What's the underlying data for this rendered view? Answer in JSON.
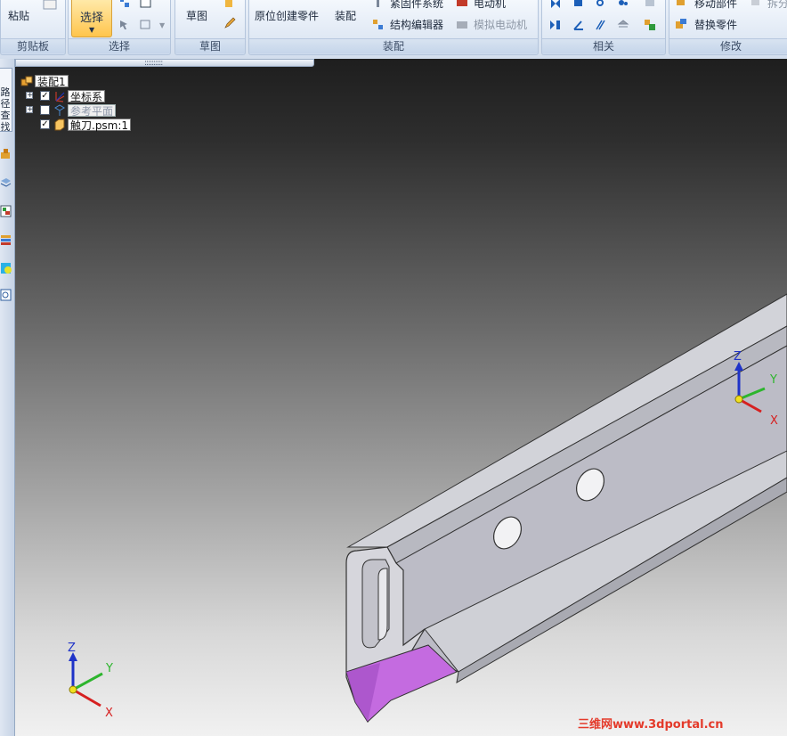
{
  "ribbon": {
    "clipboard": {
      "paste_label": "粘贴",
      "group_title": "剪贴板"
    },
    "select": {
      "select_label": "选择",
      "group_title": "选择"
    },
    "sketch": {
      "sketch_label": "草图",
      "group_title": "草图"
    },
    "assembly": {
      "inplace_create_label": "原位创建零件",
      "assemble_label": "装配",
      "fastener_label": "紧固件系统",
      "structure_editor_label": "结构编辑器",
      "motor_label": "电动机",
      "simulate_motor_label": "模拟电动机",
      "group_title": "装配"
    },
    "relate": {
      "group_title": "相关"
    },
    "modify": {
      "move_parts_label": "移动部件",
      "disperse_label": "拆分",
      "replace_part_label": "替换零件",
      "group_title": "修改"
    }
  },
  "left_toolbar": {
    "tab_label": "路径查找器"
  },
  "tree": {
    "root": "装配1",
    "items": [
      {
        "label": "坐标系",
        "checked": true,
        "expandable": true
      },
      {
        "label": "参考平面",
        "checked": false,
        "expandable": true
      },
      {
        "label": "触刀.psm:1",
        "checked": true,
        "expandable": false
      }
    ]
  },
  "triad": {
    "x": "X",
    "y": "Y",
    "z": "Z"
  },
  "watermark": "三维网www.3dportal.cn",
  "colors": {
    "highlight_face": "#c46be0",
    "part_gray": "#c9c9cf",
    "accent": "#ffc54d"
  }
}
